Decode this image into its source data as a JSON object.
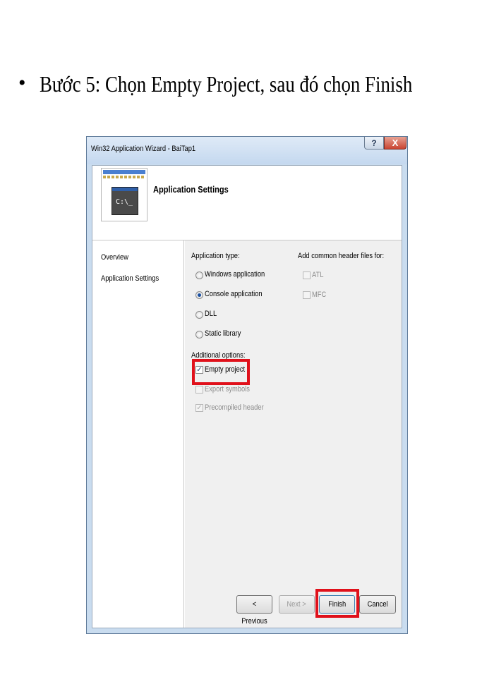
{
  "slide": {
    "bullet": "•",
    "title": "Bước 5: Chọn Empty Project, sau đó chọn Finish"
  },
  "window": {
    "title": "Win32 Application Wizard - BaiTap1",
    "help_label": "?",
    "close_label": "X"
  },
  "header": {
    "title": "Application Settings",
    "console_prompt": "C:\\_"
  },
  "nav": {
    "items": [
      {
        "label": "Overview"
      },
      {
        "label": "Application Settings"
      }
    ]
  },
  "settings": {
    "app_type_label": "Application type:",
    "app_types": [
      {
        "label": "Windows application",
        "checked": false
      },
      {
        "label": "Console application",
        "checked": true
      },
      {
        "label": "DLL",
        "checked": false
      },
      {
        "label": "Static library",
        "checked": false
      }
    ],
    "additional_label": "Additional options:",
    "options": [
      {
        "label": "Empty project",
        "checked": true,
        "enabled": true
      },
      {
        "label": "Export symbols",
        "checked": false,
        "enabled": false
      },
      {
        "label": "Precompiled header",
        "checked": true,
        "enabled": false
      }
    ],
    "headers_label": "Add common header files for:",
    "header_files": [
      {
        "label": "ATL",
        "checked": false,
        "enabled": false
      },
      {
        "label": "MFC",
        "checked": false,
        "enabled": false
      }
    ],
    "check_glyph": "✓"
  },
  "buttons": {
    "previous": "< Previous",
    "next": "Next >",
    "finish": "Finish",
    "cancel": "Cancel"
  },
  "colors": {
    "highlight": "#e0111b",
    "window_frame": "#c9dcef"
  }
}
